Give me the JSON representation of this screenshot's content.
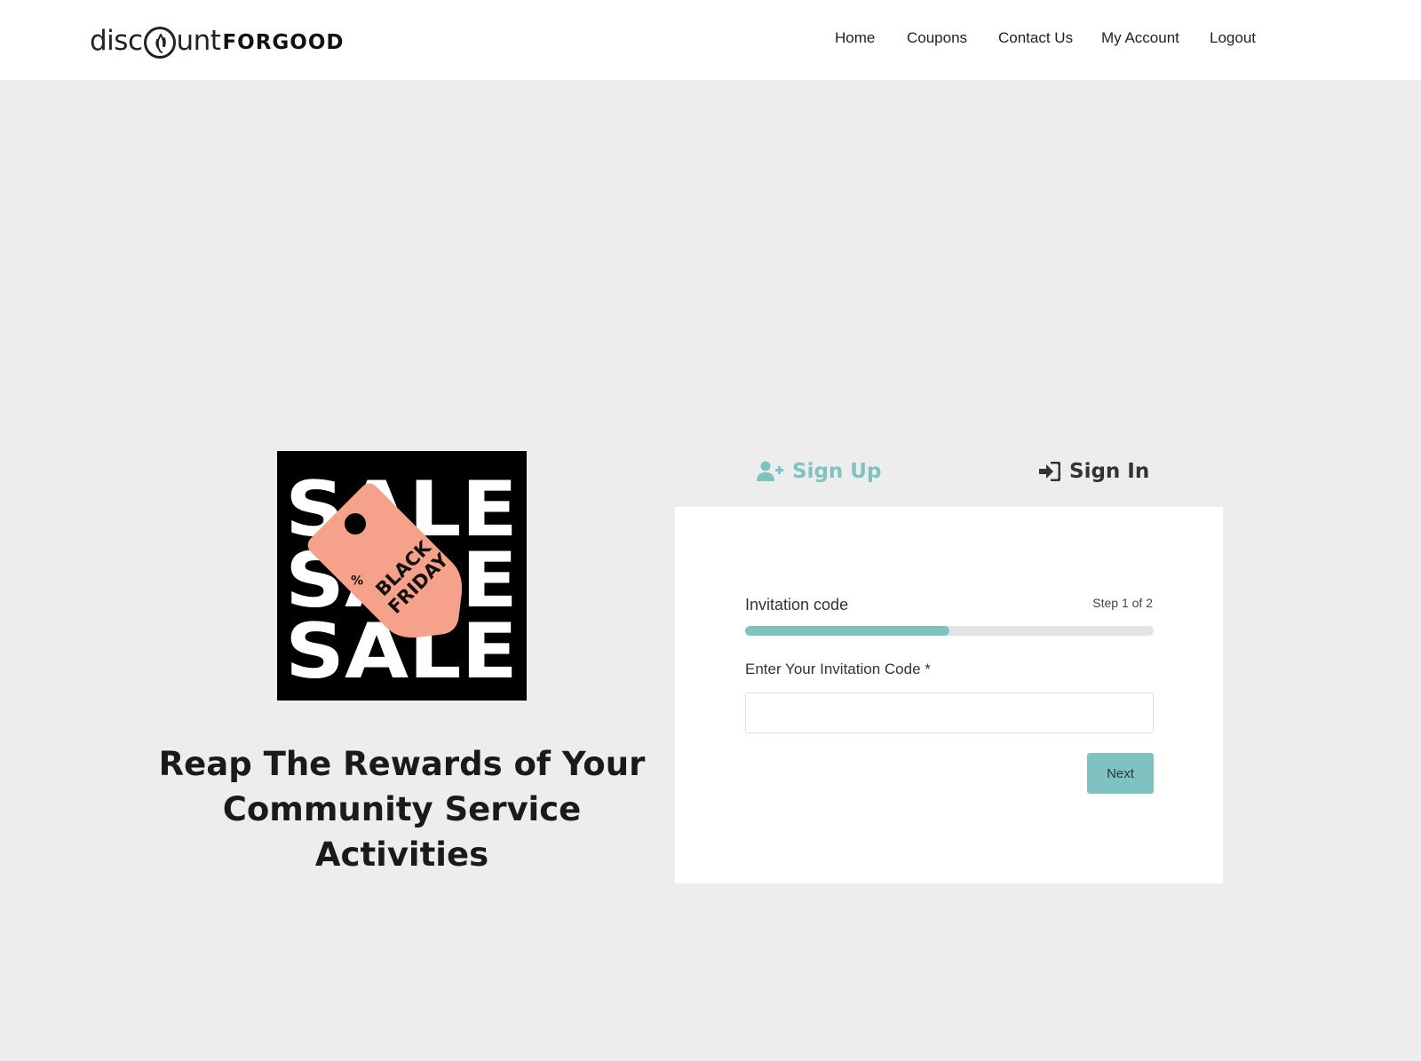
{
  "header": {
    "logo": {
      "part1": "disc",
      "part2": "unt",
      "part3": "FORGOOD"
    },
    "nav": [
      {
        "label": "Home"
      },
      {
        "label": "Coupons"
      },
      {
        "label": "Contact Us"
      },
      {
        "label": "My Account"
      },
      {
        "label": "Logout"
      }
    ]
  },
  "hero": {
    "image": {
      "words": [
        "SALE",
        "SALE",
        "SALE"
      ],
      "tag_symbol": "%",
      "tag_line1": "BLACK",
      "tag_line2": "FRIDAY"
    },
    "tagline": "Reap The Rewards of Your Community Service Activities"
  },
  "tabs": {
    "signup": {
      "label": "Sign Up",
      "icon": "user-plus-icon",
      "active": true
    },
    "signin": {
      "label": "Sign In",
      "icon": "sign-in-icon",
      "active": false
    }
  },
  "form": {
    "step_title": "Invitation code",
    "step_count": "Step 1 of 2",
    "progress": 0.5,
    "field_label": "Enter Your Invitation Code *",
    "field_value": "",
    "field_placeholder": "",
    "next_label": "Next"
  },
  "colors": {
    "accent": "#7fc3c1",
    "tag": "#f6a18a",
    "background": "#ededed"
  }
}
